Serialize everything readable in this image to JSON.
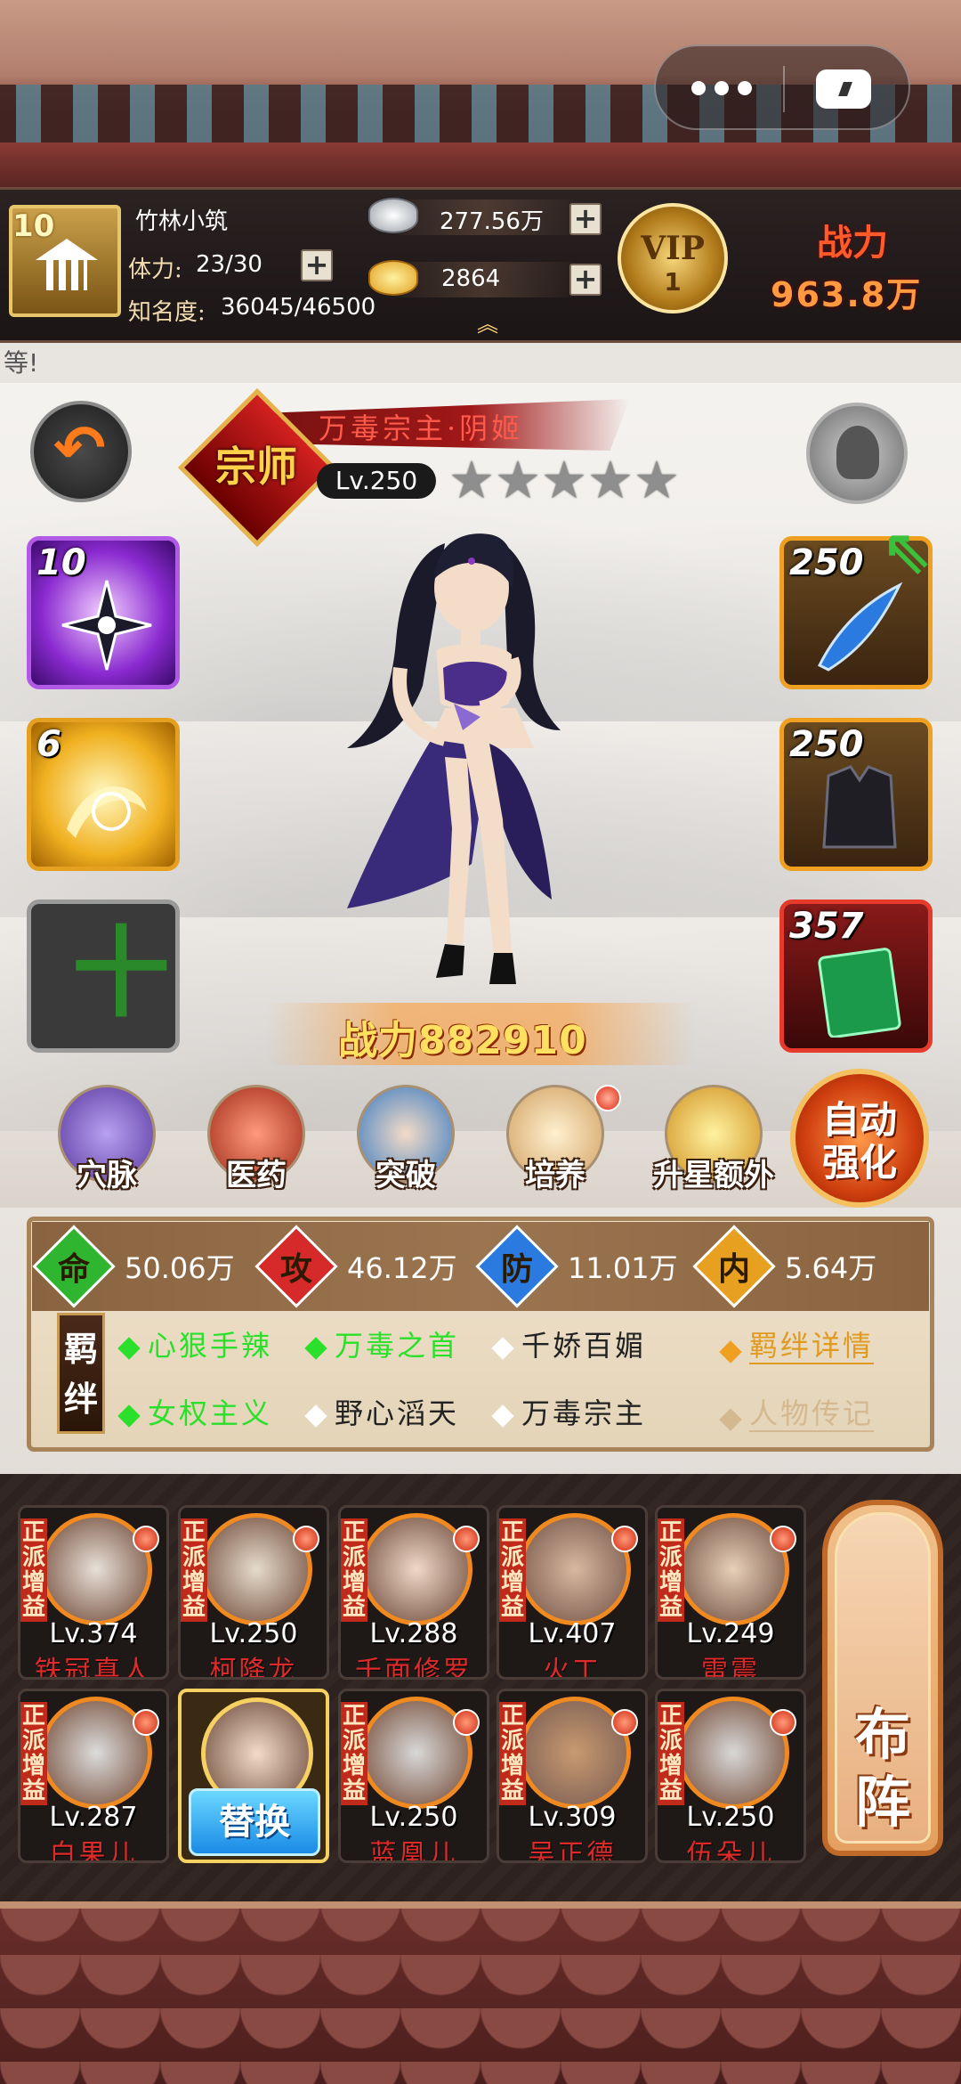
{
  "capsule": {
    "more_icon": "ellipsis-icon",
    "game_icon": "gamepad-icon"
  },
  "player": {
    "level": "10",
    "name": "竹林小筑",
    "stamina_label": "体力:",
    "stamina": "23/30",
    "fame_label": "知名度:",
    "fame": "36045/46500",
    "silver": "277.56万",
    "gold": "2864",
    "vip_text": "VIP",
    "vip_level": "1",
    "power_label": "战力",
    "power": "963.8万"
  },
  "notice": "等!",
  "hero": {
    "rank": "宗师",
    "name": "万毒宗主·阴姬",
    "level": "Lv.250",
    "stars_total": 5,
    "stars_filled": 0,
    "power_text": "战力882910"
  },
  "skills": [
    {
      "level": "10",
      "icon": "shuriken-skill-icon"
    },
    {
      "level": "6",
      "icon": "golden-wind-skill-icon"
    },
    {
      "level": "",
      "icon": "add-skill-icon"
    }
  ],
  "equipment": [
    {
      "level": "250",
      "icon": "blade-weapon-icon"
    },
    {
      "level": "250",
      "icon": "armor-vest-icon"
    },
    {
      "level": "357",
      "icon": "green-book-icon"
    }
  ],
  "functions": [
    {
      "label": "穴脉",
      "icon": "meridian-icon",
      "badge": false
    },
    {
      "label": "医药",
      "icon": "herb-icon",
      "badge": false
    },
    {
      "label": "突破",
      "icon": "breakthrough-icon",
      "badge": false
    },
    {
      "label": "培养",
      "icon": "scroll-icon",
      "badge": true
    },
    {
      "label": "升星额外",
      "icon": "star-up-icon",
      "badge": false
    }
  ],
  "auto_button": {
    "line1": "自动",
    "line2": "强化"
  },
  "attributes": [
    {
      "key": "命",
      "value": "50.06万",
      "color": "#2fb52f"
    },
    {
      "key": "攻",
      "value": "46.12万",
      "color": "#d62a2a"
    },
    {
      "key": "防",
      "value": "11.01万",
      "color": "#2a7ae0"
    },
    {
      "key": "内",
      "value": "5.64万",
      "color": "#e8a020"
    }
  ],
  "bond_label": "羁绊",
  "bonds": [
    {
      "text": "心狠手辣",
      "active": true
    },
    {
      "text": "万毒之首",
      "active": true
    },
    {
      "text": "千娇百媚",
      "active": false
    },
    {
      "text": "女权主义",
      "active": true
    },
    {
      "text": "野心滔天",
      "active": false
    },
    {
      "text": "万毒宗主",
      "active": false
    }
  ],
  "links": {
    "bond_detail": "羁绊详情",
    "biography": "人物传记"
  },
  "roster_tag": "正派增益",
  "roster": [
    {
      "level": "Lv.374",
      "name": "铁冠真人"
    },
    {
      "level": "Lv.250",
      "name": "柯降龙"
    },
    {
      "level": "Lv.288",
      "name": "千面修罗"
    },
    {
      "level": "Lv.407",
      "name": "火工"
    },
    {
      "level": "Lv.249",
      "name": "雷震"
    },
    {
      "level": "Lv.287",
      "name": "白果儿"
    },
    {
      "level": "",
      "name": "",
      "swap": "替换"
    },
    {
      "level": "Lv.250",
      "name": "蓝凰儿"
    },
    {
      "level": "Lv.309",
      "name": "吴正德"
    },
    {
      "level": "Lv.250",
      "name": "伍朵儿"
    }
  ],
  "formation": "布阵",
  "colors": {
    "accent_orange": "#f08a20",
    "bond_active": "#2ae02a",
    "header_bg": "#1b1515"
  }
}
